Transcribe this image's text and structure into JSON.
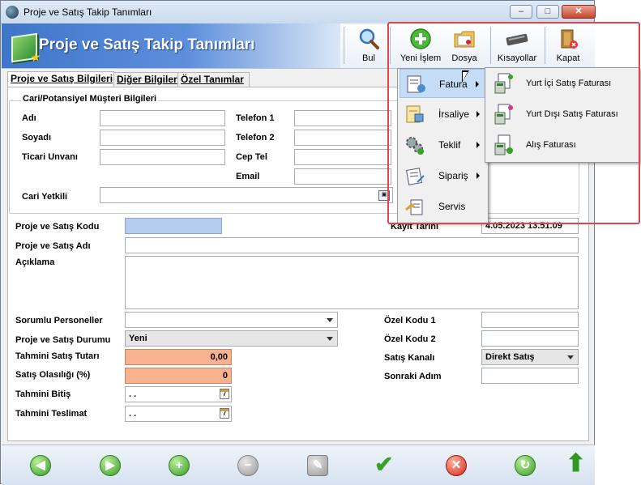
{
  "titlebar": {
    "title": "Proje ve Satış Takip Tanımları"
  },
  "toolbar": {
    "banner_title": "Proje ve Satış Takip Tanımları",
    "buttons": [
      {
        "label": "Bul",
        "icon": "magnifier-icon"
      },
      {
        "label": "Yeni İşlem",
        "icon": "plus-circle-icon"
      },
      {
        "label": "Dosya",
        "icon": "folder-icon"
      },
      {
        "label": "Kısayollar",
        "icon": "keyboard-icon"
      },
      {
        "label": "Kapat",
        "icon": "exit-door-icon"
      }
    ]
  },
  "tabs": [
    {
      "label": "Proje ve Satış Bilgileri",
      "active": true
    },
    {
      "label": "Diğer Bilgiler",
      "active": false
    },
    {
      "label": "Özel Tanımlar",
      "active": false
    }
  ],
  "customer_section": {
    "title": "Cari/Potansiyel Müşteri Bilgileri",
    "labels": {
      "name": "Adı",
      "surname": "Soyadı",
      "trade_title": "Ticari Unvanı",
      "phone1": "Telefon 1",
      "phone2": "Telefon 2",
      "mobile": "Cep Tel",
      "email": "Email",
      "contact": "Cari Yetkili"
    }
  },
  "form": {
    "labels": {
      "code": "Proje ve Satış Kodu",
      "name": "Proje ve Satış Adı",
      "description": "Açıklama",
      "record_date": "Kayıt Tarihi",
      "responsible": "Sorumlu Personeller",
      "status": "Proje ve Satış Durumu",
      "estimated_amount": "Tahmini Satış Tutarı",
      "probability": "Satış Olasılığı (%)",
      "estimated_end": "Tahmini Bitiş",
      "estimated_delivery": "Tahmini Teslimat",
      "special_code1": "Özel Kodu 1",
      "special_code2": "Özel Kodu 2",
      "sales_channel": "Satış Kanalı",
      "next_step": "Sonraki Adım"
    },
    "values": {
      "record_date": "4.05.2023 13.51.09",
      "status": "Yeni",
      "estimated_amount": "0,00",
      "probability": "0",
      "estimated_end": ". .",
      "estimated_delivery": ". .",
      "sales_channel": "Direkt Satış"
    }
  },
  "context_menu": {
    "items": [
      {
        "label": "Fatura",
        "icon": "invoice-icon",
        "has_submenu": true,
        "highlighted": true
      },
      {
        "label": "İrsaliye",
        "icon": "waybill-icon",
        "has_submenu": true,
        "highlighted": false
      },
      {
        "label": "Teklif",
        "icon": "gears-icon",
        "has_submenu": true,
        "highlighted": false
      },
      {
        "label": "Sipariş",
        "icon": "order-icon",
        "has_submenu": true,
        "highlighted": false
      },
      {
        "label": "Servis",
        "icon": "service-icon",
        "has_submenu": false,
        "highlighted": false
      }
    ]
  },
  "submenu": {
    "items": [
      {
        "label": "Yurt İçi Satış Faturası",
        "icon": "domestic-sales-invoice-icon"
      },
      {
        "label": "Yurt Dışı Satış Faturası",
        "icon": "foreign-sales-invoice-icon"
      },
      {
        "label": "Alış Faturası",
        "icon": "purchase-invoice-icon"
      }
    ]
  },
  "footer": {
    "buttons": [
      {
        "icon": "arrow-left-icon"
      },
      {
        "icon": "arrow-right-icon"
      },
      {
        "icon": "add-record-icon"
      },
      {
        "icon": "delete-record-icon"
      },
      {
        "icon": "edit-record-icon"
      },
      {
        "icon": "save-check-icon"
      },
      {
        "icon": "cancel-icon"
      },
      {
        "icon": "refresh-icon"
      },
      {
        "icon": "arrow-up-icon"
      }
    ]
  }
}
